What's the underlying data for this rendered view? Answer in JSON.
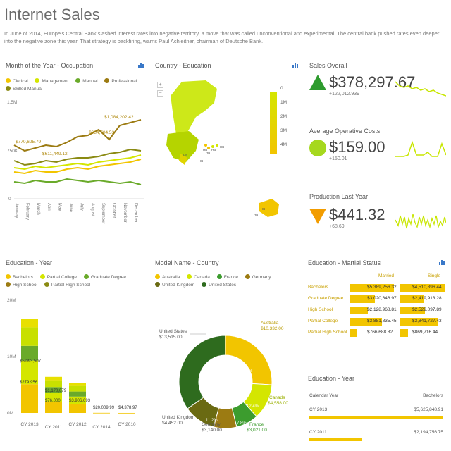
{
  "header": {
    "title": "Internet Sales",
    "description": "In June of 2014, Europe's Central Bank slashed interest rates into negative territory, a move that was called unconventional and experimental. The central bank pushed rates even deeper into the negative zone this year. That strategy is backfiring, warns Paul Achleitner, chairman of Deutsche Bank."
  },
  "colors": {
    "clerical": "#f2c500",
    "management": "#d4e600",
    "manual": "#6aaa2a",
    "professional": "#9c7b12",
    "skilled": "#8a8a12",
    "dark_green": "#2e6b1e",
    "green": "#3c9c2e",
    "yellow": "#f2c500",
    "lime": "#c8e600"
  },
  "occupation": {
    "title": "Month of the Year - Occupation",
    "legend": [
      "Clerical",
      "Management",
      "Manual",
      "Professional",
      "Skilled Manual"
    ],
    "y_tick": "1.5M",
    "labels": [
      "$770,625.79",
      "$611,449.12",
      "$984,704.53",
      "$1,084,202.42"
    ],
    "y_mid": "750K",
    "y_zero": "0"
  },
  "education_map": {
    "title": "Country - Education",
    "scale": [
      "0",
      "1M",
      "2M",
      "3M",
      "4M"
    ]
  },
  "kpis": [
    {
      "label": "Sales Overall",
      "value": "$378,297.67",
      "sub": "+122,012.939"
    },
    {
      "label": "Average Operative Costs",
      "value": "$159.00",
      "sub": "+150.01"
    },
    {
      "label": "Production Last Year",
      "value": "$441.32",
      "sub": "+68.69"
    }
  ],
  "education_year": {
    "title": "Education - Year",
    "legend": [
      "Bachelors",
      "Partial College",
      "Graduate Degree",
      "High School",
      "Partial High School"
    ],
    "y_ticks": [
      "20M",
      "10M",
      "0M"
    ],
    "labels": [
      "$5,093,507",
      "$279,956",
      "$1,170,079",
      "$76,000",
      "$3,906,693",
      "$20,009.99",
      "$4,378.97"
    ],
    "chart_data": {
      "type": "bar",
      "categories": [
        "CY 2013",
        "CY 2011",
        "CY 2012",
        "CY 2014",
        "CY 2010"
      ],
      "series": [
        {
          "name": "Bachelors",
          "values": [
            5.1,
            1.9,
            1.6,
            0.02,
            0.004
          ]
        },
        {
          "name": "Partial College",
          "values": [
            4.2,
            1.6,
            1.3,
            0.0,
            0.0
          ]
        },
        {
          "name": "Graduate Degree",
          "values": [
            2.6,
            1.1,
            0.9,
            0.0,
            0.0
          ]
        },
        {
          "name": "High School",
          "values": [
            3.3,
            1.2,
            1.0,
            0.0,
            0.0
          ]
        },
        {
          "name": "Partial High School",
          "values": [
            1.5,
            0.6,
            0.5,
            0.0,
            0.0
          ]
        }
      ],
      "ylim": [
        0,
        20
      ]
    }
  },
  "model_country": {
    "title": "Model Name - Country",
    "legend": [
      "Australia",
      "Canada",
      "France",
      "Germany",
      "United Kingdom",
      "United States"
    ],
    "labels": {
      "united_states": "United States",
      "united_states_val": "$13,515.00",
      "australia": "Australia",
      "australia_val": "$10,332.00",
      "canada": "Canada",
      "canada_val": "$4,558.00",
      "france": "France",
      "france_val": "$3,021.00",
      "germany": "Germany",
      "germany_val": "$3,140.00",
      "uk": "United Kingdom",
      "uk_val": "$4,452.00",
      "pct_us": "34.9%",
      "pct_au": "26.1%",
      "pct_ca": "12.4%",
      "pct_fr": "7.8%",
      "pct_de": "8%",
      "pct_uk": "11.2%"
    },
    "chart_data": {
      "type": "pie",
      "categories": [
        "Australia",
        "Canada",
        "France",
        "Germany",
        "United Kingdom",
        "United States"
      ],
      "values": [
        26.1,
        12.4,
        7.8,
        8.0,
        11.2,
        34.9
      ]
    }
  },
  "marital": {
    "title": "Education - Martial Status",
    "col1": "Married",
    "col2": "Single",
    "rows": [
      {
        "name": "Bachelors",
        "married": "$5,389,256.32",
        "single": "$4,510,896.44",
        "m_frac": 1.0,
        "s_frac": 1.0
      },
      {
        "name": "Graduate Degree",
        "married": "$3,020,646.97",
        "single": "$2,419,913.28",
        "m_frac": 0.56,
        "s_frac": 0.54
      },
      {
        "name": "High School",
        "married": "$2,128,968.81",
        "single": "$2,529,097.89",
        "m_frac": 0.4,
        "s_frac": 0.56
      },
      {
        "name": "Partial College",
        "married": "$3,881,835.45",
        "single": "$3,841,727.43",
        "m_frac": 0.72,
        "s_frac": 0.85
      },
      {
        "name": "Partial High School",
        "married": "$766,688.82",
        "single": "$869,716.44",
        "m_frac": 0.14,
        "s_frac": 0.19
      }
    ]
  },
  "edu_year_table": {
    "title": "Education - Year",
    "col1": "Calendar Year",
    "col2": "Bachelors",
    "rows": [
      {
        "year": "CY 2013",
        "value": "$5,625,848.91",
        "frac": 1.0
      },
      {
        "year": "CY 2011",
        "value": "$2,194,756.75",
        "frac": 0.39
      }
    ]
  },
  "months": [
    "January",
    "February",
    "March",
    "April",
    "May",
    "June",
    "July",
    "August",
    "September",
    "October",
    "November",
    "December"
  ]
}
